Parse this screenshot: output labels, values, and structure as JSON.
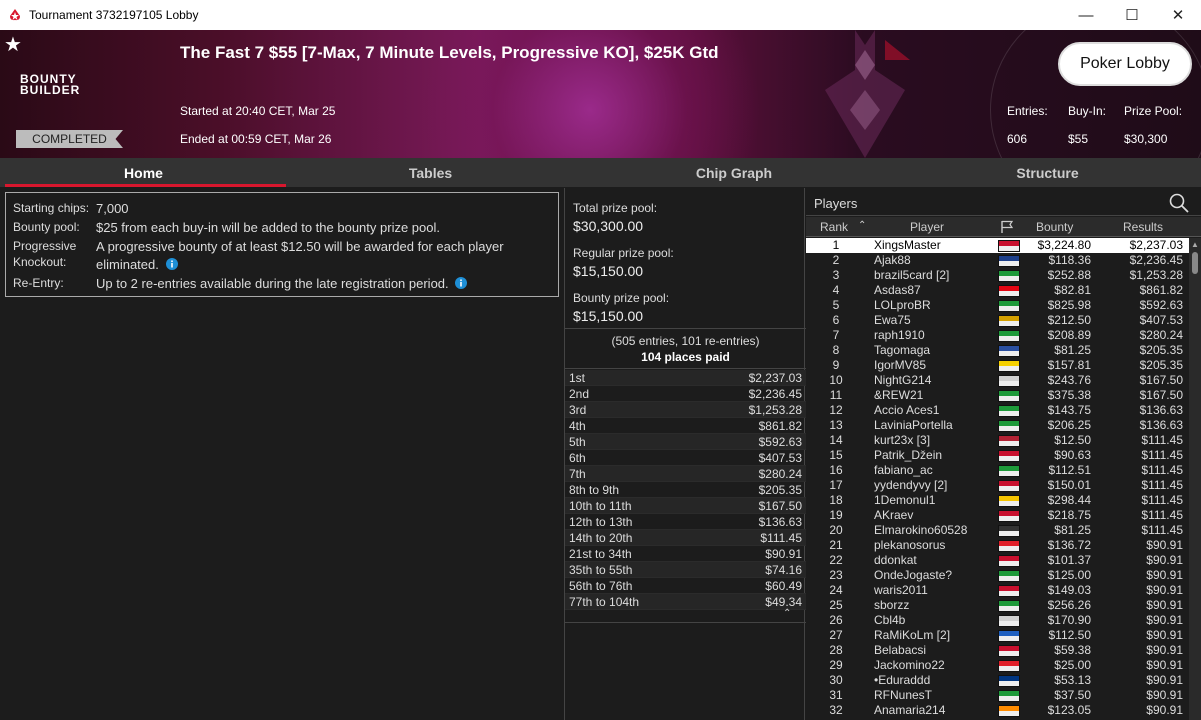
{
  "window": {
    "title": "Tournament 3732197105 Lobby"
  },
  "header": {
    "title": "The Fast 7 $55 [7-Max, 7 Minute Levels, Progressive KO], $25K Gtd",
    "brand_line1": "BOUNTY",
    "brand_line2": "BUILDER",
    "status": "COMPLETED",
    "started": "Started at 20:40 CET, Mar 25",
    "ended": "Ended at 00:59 CET, Mar 26",
    "lobby_button": "Poker Lobby",
    "entries_label": "Entries:",
    "buyin_label": "Buy-In:",
    "prizepool_label": "Prize Pool:",
    "entries": "606",
    "buyin": "$55",
    "prizepool": "$30,300"
  },
  "tabs": [
    "Home",
    "Tables",
    "Chip Graph",
    "Structure"
  ],
  "info": {
    "starting_chips_label": "Starting chips:",
    "starting_chips": "7,000",
    "bounty_pool_label": "Bounty pool:",
    "bounty_pool": "$25 from each buy-in will be added to the bounty prize pool.",
    "pk_label1": "Progressive",
    "pk_label2": "Knockout:",
    "pk_line1": "A progressive bounty of at least $12.50 will be awarded for each player",
    "pk_line2": "eliminated.",
    "reentry_label": "Re-Entry:",
    "reentry": "Up to 2 re-entries available during the late registration period."
  },
  "prizes": {
    "total_label": "Total prize pool:",
    "total": "$30,300.00",
    "regular_label": "Regular prize pool:",
    "regular": "$15,150.00",
    "bounty_label": "Bounty prize pool:",
    "bounty": "$15,150.00",
    "entries_note": "(505 entries, 101 re-entries)",
    "places_paid": "104 places paid",
    "payouts": [
      {
        "place": "1st",
        "amount": "$2,237.03"
      },
      {
        "place": "2nd",
        "amount": "$2,236.45"
      },
      {
        "place": "3rd",
        "amount": "$1,253.28"
      },
      {
        "place": "4th",
        "amount": "$861.82"
      },
      {
        "place": "5th",
        "amount": "$592.63"
      },
      {
        "place": "6th",
        "amount": "$407.53"
      },
      {
        "place": "7th",
        "amount": "$280.24"
      },
      {
        "place": "8th to 9th",
        "amount": "$205.35"
      },
      {
        "place": "10th to 11th",
        "amount": "$167.50"
      },
      {
        "place": "12th to 13th",
        "amount": "$136.63"
      },
      {
        "place": "14th to 20th",
        "amount": "$111.45"
      },
      {
        "place": "21st to 34th",
        "amount": "$90.91"
      },
      {
        "place": "35th to 55th",
        "amount": "$74.16"
      },
      {
        "place": "56th to 76th",
        "amount": "$60.49"
      },
      {
        "place": "77th to 104th",
        "amount": "$49.34"
      }
    ]
  },
  "players": {
    "heading": "Players",
    "cols": {
      "rank": "Rank",
      "player": "Player",
      "bounty": "Bounty",
      "results": "Results"
    },
    "rows": [
      {
        "rank": "1",
        "name": "XingsMaster",
        "bounty": "$3,224.80",
        "result": "$2,237.03",
        "flag": "#c8102e"
      },
      {
        "rank": "2",
        "name": "Ajak88",
        "bounty": "$118.36",
        "result": "$2,236.45",
        "flag": "#1d3f8a"
      },
      {
        "rank": "3",
        "name": "brazil5card [2]",
        "bounty": "$252.88",
        "result": "$1,253.28",
        "flag": "#1e9a3a"
      },
      {
        "rank": "4",
        "name": "Asdas87",
        "bounty": "$82.81",
        "result": "$861.82",
        "flag": "#e30613"
      },
      {
        "rank": "5",
        "name": "LOLproBR",
        "bounty": "$825.98",
        "result": "$592.63",
        "flag": "#1e9a3a"
      },
      {
        "rank": "6",
        "name": "Ewa75",
        "bounty": "$212.50",
        "result": "$407.53",
        "flag": "#d4a000"
      },
      {
        "rank": "7",
        "name": "raph1910",
        "bounty": "$208.89",
        "result": "$280.24",
        "flag": "#1e9a3a"
      },
      {
        "rank": "8",
        "name": "Tagomaga",
        "bounty": "$81.25",
        "result": "$205.35",
        "flag": "#2a4fa0"
      },
      {
        "rank": "9",
        "name": "IgorMV85",
        "bounty": "$157.81",
        "result": "$205.35",
        "flag": "#f5d000"
      },
      {
        "rank": "10",
        "name": "NightG214",
        "bounty": "$243.76",
        "result": "$167.50",
        "flag": "#d0d0d0"
      },
      {
        "rank": "11",
        "name": "&REW21",
        "bounty": "$375.38",
        "result": "$167.50",
        "flag": "#1e9a3a"
      },
      {
        "rank": "12",
        "name": "Accio Aces1",
        "bounty": "$143.75",
        "result": "$136.63",
        "flag": "#1e9a3a"
      },
      {
        "rank": "13",
        "name": "LaviniaPortella",
        "bounty": "$206.25",
        "result": "$136.63",
        "flag": "#1e9a3a"
      },
      {
        "rank": "14",
        "name": "kurt23x [3]",
        "bounty": "$12.50",
        "result": "$111.45",
        "flag": "#b22234"
      },
      {
        "rank": "15",
        "name": "Patrik_Džein",
        "bounty": "$90.63",
        "result": "$111.45",
        "flag": "#c8102e"
      },
      {
        "rank": "16",
        "name": "fabiano_ac",
        "bounty": "$112.51",
        "result": "$111.45",
        "flag": "#1e9a3a"
      },
      {
        "rank": "17",
        "name": "yydendyvy [2]",
        "bounty": "$150.01",
        "result": "$111.45",
        "flag": "#c8102e"
      },
      {
        "rank": "18",
        "name": "1Demonul1",
        "bounty": "$298.44",
        "result": "$111.45",
        "flag": "#f5c400"
      },
      {
        "rank": "19",
        "name": "AKraev",
        "bounty": "$218.75",
        "result": "$111.45",
        "flag": "#c8102e"
      },
      {
        "rank": "20",
        "name": "Elmarokino60528",
        "bounty": "$81.25",
        "result": "$111.45",
        "flag": "#333333"
      },
      {
        "rank": "21",
        "name": "plekanosorus",
        "bounty": "$136.72",
        "result": "$90.91",
        "flag": "#e0202a"
      },
      {
        "rank": "22",
        "name": "ddonkat",
        "bounty": "$101.37",
        "result": "$90.91",
        "flag": "#c8102e"
      },
      {
        "rank": "23",
        "name": "OndeJogaste?",
        "bounty": "$125.00",
        "result": "$90.91",
        "flag": "#1e9a3a"
      },
      {
        "rank": "24",
        "name": "waris2011",
        "bounty": "$149.03",
        "result": "$90.91",
        "flag": "#c8102e"
      },
      {
        "rank": "25",
        "name": "sborzz",
        "bounty": "$256.26",
        "result": "$90.91",
        "flag": "#1e9a3a"
      },
      {
        "rank": "26",
        "name": "Cbl4b",
        "bounty": "$170.90",
        "result": "$90.91",
        "flag": "#d0d0d0"
      },
      {
        "rank": "27",
        "name": "RaMiKoLm [2]",
        "bounty": "$112.50",
        "result": "$90.91",
        "flag": "#1f5fbf"
      },
      {
        "rank": "28",
        "name": "Belabacsi",
        "bounty": "$59.38",
        "result": "$90.91",
        "flag": "#c8102e"
      },
      {
        "rank": "29",
        "name": "Jackomino22",
        "bounty": "$25.00",
        "result": "$90.91",
        "flag": "#e0202a"
      },
      {
        "rank": "30",
        "name": "•Eduraddd",
        "bounty": "$53.13",
        "result": "$90.91",
        "flag": "#003580"
      },
      {
        "rank": "31",
        "name": "RFNunesT",
        "bounty": "$37.50",
        "result": "$90.91",
        "flag": "#1e9a3a"
      },
      {
        "rank": "32",
        "name": "Anamaria214",
        "bounty": "$123.05",
        "result": "$90.91",
        "flag": "#ff8c00"
      }
    ]
  }
}
